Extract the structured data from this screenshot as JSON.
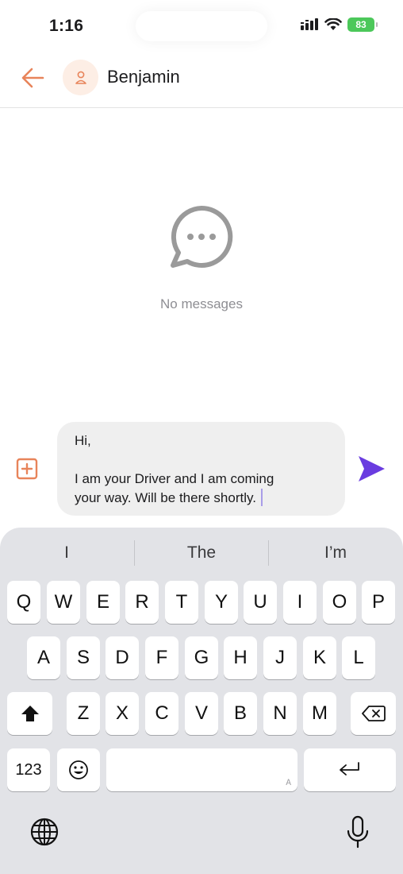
{
  "status_bar": {
    "time": "1:16",
    "battery": "83"
  },
  "header": {
    "contact_name": "Benjamin"
  },
  "empty_state": {
    "text": "No messages"
  },
  "composer": {
    "lines": [
      "Hi,",
      "",
      "I am your Driver and I am coming",
      "your way. Will be there shortly."
    ]
  },
  "keyboard": {
    "suggestions": [
      "I",
      "The",
      "I’m"
    ],
    "row1": [
      "Q",
      "W",
      "E",
      "R",
      "T",
      "Y",
      "U",
      "I",
      "O",
      "P"
    ],
    "row2": [
      "A",
      "S",
      "D",
      "F",
      "G",
      "H",
      "J",
      "K",
      "L"
    ],
    "row3": [
      "Z",
      "X",
      "C",
      "V",
      "B",
      "N",
      "M"
    ],
    "numbers_label": "123",
    "space_hint": "A"
  },
  "colors": {
    "accent": "#e8845a",
    "send": "#6a3ce0"
  }
}
